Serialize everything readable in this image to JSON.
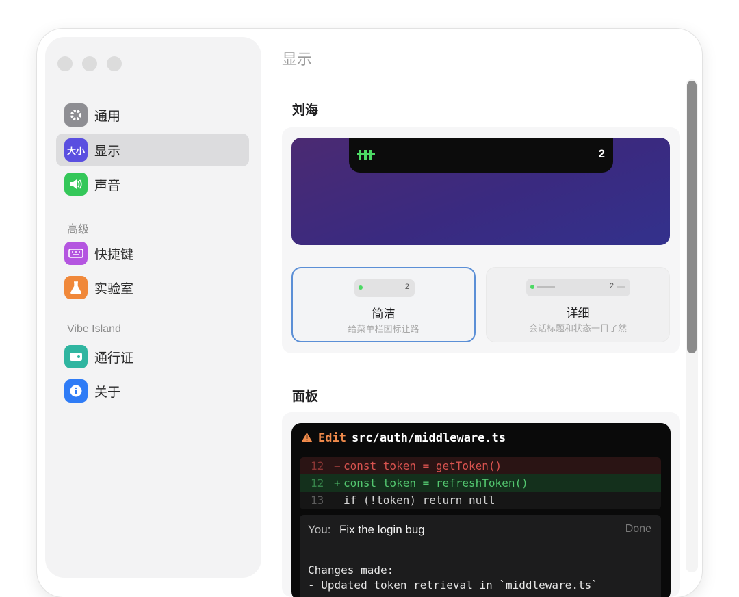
{
  "page_title": "显示",
  "sidebar": {
    "items": [
      {
        "label": "通用",
        "icon": "gear-icon",
        "icon_color": "#8e8e93"
      },
      {
        "label": "显示",
        "icon": "text-size-icon",
        "icon_text": "大小",
        "icon_color": "#5a4fe0"
      },
      {
        "label": "声音",
        "icon": "speaker-icon",
        "icon_color": "#34c759"
      },
      {
        "label": "快捷键",
        "icon": "keyboard-icon",
        "icon_color": "#b455e0"
      },
      {
        "label": "实验室",
        "icon": "flask-icon",
        "icon_color": "#f0883a"
      },
      {
        "label": "通行证",
        "icon": "wallet-icon",
        "icon_color": "#2fb5a0"
      },
      {
        "label": "关于",
        "icon": "info-icon",
        "icon_color": "#2f7cf6"
      }
    ],
    "sections": [
      "高级",
      "Vibe Island"
    ],
    "selected_index": 1
  },
  "notch": {
    "title": "刘海",
    "preview_count": "2",
    "options": [
      {
        "title": "简洁",
        "subtitle": "给菜单栏图标让路",
        "mini_count": "2"
      },
      {
        "title": "详细",
        "subtitle": "会话标题和状态一目了然",
        "mini_count": "2"
      }
    ]
  },
  "panel": {
    "title": "面板",
    "edit_label": "Edit",
    "file": "src/auth/middleware.ts",
    "diff": [
      {
        "line": "12",
        "sign": "−",
        "code": "const token = getToken()",
        "kind": "del"
      },
      {
        "line": "12",
        "sign": "+",
        "code": "const token = refreshToken()",
        "kind": "add"
      },
      {
        "line": "13",
        "sign": "",
        "code": "if (!token) return null",
        "kind": "ctx"
      }
    ],
    "chat": {
      "you_label": "You:",
      "message": "Fix the login bug",
      "status": "Done",
      "changes_title": "Changes made:",
      "changes_line": "- Updated token retrieval in `middleware.ts`"
    }
  },
  "colors": {
    "selection": "#dcdcde",
    "accent_border": "#5b8fd6",
    "warn": "#f08a4b"
  }
}
